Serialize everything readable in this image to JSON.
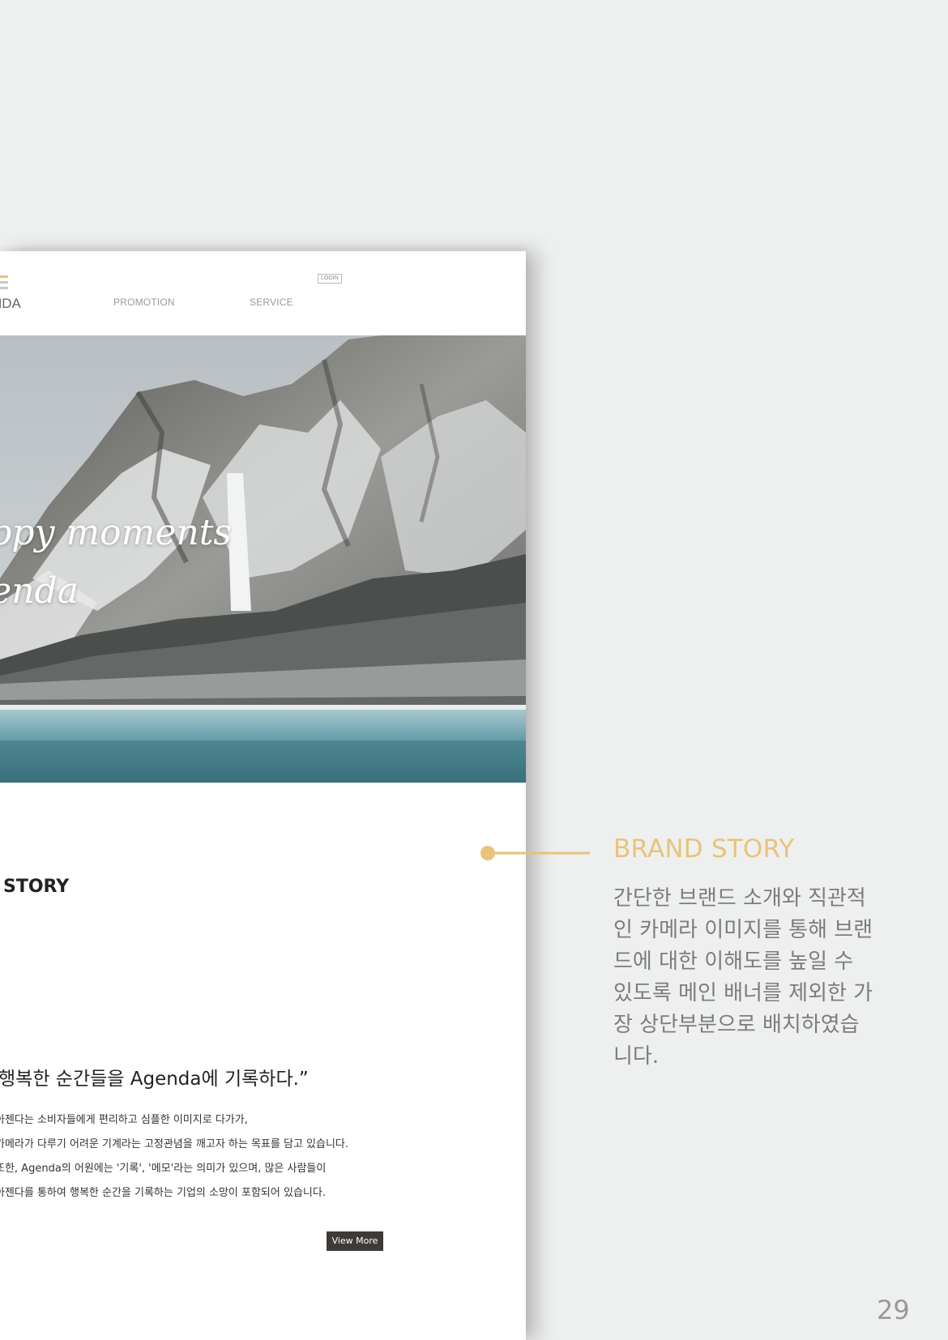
{
  "header": {
    "logo_text": "NDA",
    "nav": [
      "PROMOTION",
      "SERVICE"
    ],
    "login_label": "LOGIN"
  },
  "hero": {
    "tagline_line1": "appy moments",
    "tagline_line2": "genda",
    "image": "snowy-mountain-lake-photo"
  },
  "section": {
    "heading": "STORY",
    "quote": "행복한 순간들을 Agenda에 기록하다.”",
    "body": [
      "아젠다는 소비자들에게 편리하고 심플한 이미지로 다가가,",
      "카메라가 다루기 어려운 기계라는 고정관념을 깨고자 하는 목표를 담고 있습니다.",
      "또한, Agenda의 어원에는 '기록', '메모'라는 의미가 있으며, 많은 사람들이",
      "아젠다를 통하여 행복한 순간을 기록하는 기업의 소망이 포함되어 있습니다."
    ],
    "button_label": "View More"
  },
  "annotation": {
    "title": "BRAND STORY",
    "lines": [
      "간단한 브랜드 소개와 직관적",
      "인 카메라 이미지를 통해 브랜",
      "드에 대한 이해도를 높일 수",
      "있도록 메인 배너를 제외한 가",
      "장 상단부분으로 배치하였습",
      "니다."
    ],
    "accent_color": "#e9c27b"
  },
  "page_number": "29"
}
